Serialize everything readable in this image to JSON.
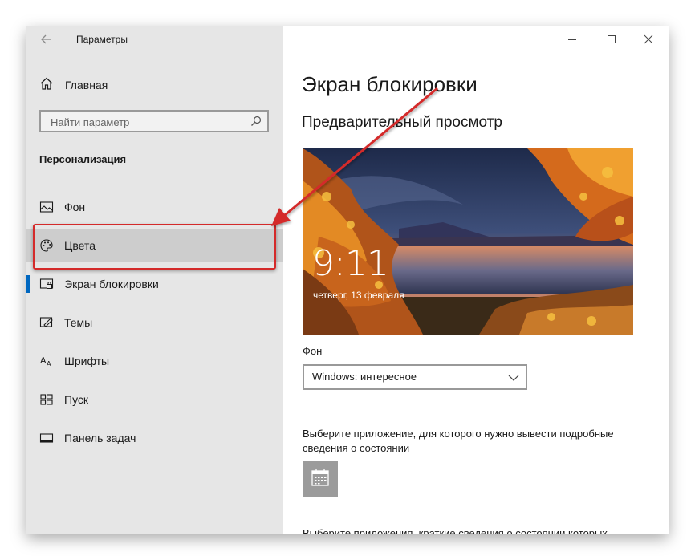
{
  "window": {
    "title": "Параметры"
  },
  "sidebar": {
    "home_label": "Главная",
    "search_placeholder": "Найти параметр",
    "section_title": "Персонализация",
    "items": [
      {
        "label": "Фон",
        "icon": "picture-icon"
      },
      {
        "label": "Цвета",
        "icon": "palette-icon"
      },
      {
        "label": "Экран блокировки",
        "icon": "lock-screen-icon"
      },
      {
        "label": "Темы",
        "icon": "themes-icon"
      },
      {
        "label": "Шрифты",
        "icon": "fonts-icon"
      },
      {
        "label": "Пуск",
        "icon": "start-icon"
      },
      {
        "label": "Панель задач",
        "icon": "taskbar-icon"
      }
    ],
    "active_item": "Экран блокировки",
    "highlighted_item": "Цвета"
  },
  "main": {
    "page_title": "Экран блокировки",
    "preview_title": "Предварительный просмотр",
    "preview": {
      "time": "9:11",
      "date": "четверг, 13 февраля"
    },
    "background_label": "Фон",
    "background_select_value": "Windows: интересное",
    "app_status_description": "Выберите приложение, для которого нужно вывести подробные сведения о состоянии",
    "app_status_icon": "calendar-icon",
    "quick_status_description": "Выберите приложения, краткие сведения о состоянии которых"
  },
  "colors": {
    "accent": "#0067c0",
    "annotation": "#d42a2a",
    "sidebar_bg": "#e6e6e6"
  }
}
